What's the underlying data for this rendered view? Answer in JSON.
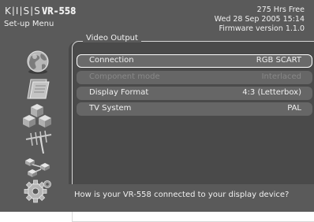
{
  "header": {
    "logo_text": "KISS VR-558",
    "menu_title": "Set-up Menu",
    "free_space": "275 Hrs Free",
    "datetime": "Wed 28 Sep 2005 15:14",
    "firmware": "Firmware version 1.1.0"
  },
  "section": {
    "title": "Video Output"
  },
  "settings": [
    {
      "label": "Connection",
      "value": "RGB SCART",
      "state": "selected"
    },
    {
      "label": "Component mode",
      "value": "Interlaced",
      "state": "disabled"
    },
    {
      "label": "Display Format",
      "value": "4:3 (Letterbox)",
      "state": "normal"
    },
    {
      "label": "TV System",
      "value": "PAL",
      "state": "normal"
    }
  ],
  "sidebar": {
    "icons": [
      "globe-icon",
      "folder-icon",
      "blocks-icon",
      "antenna-icon",
      "network-icon",
      "gear-icon"
    ]
  },
  "hint": {
    "text": "How is your VR-558 connected to your display device?"
  }
}
